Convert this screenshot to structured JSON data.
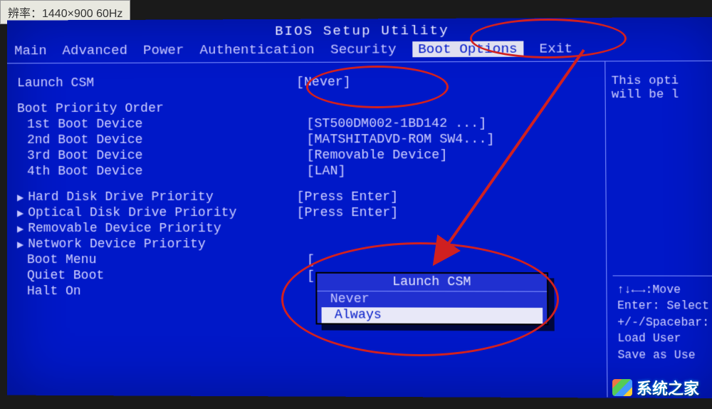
{
  "monitor_label": "辨率：1440×900 60Hz",
  "header": {
    "title": "BIOS Setup Utility",
    "tabs": [
      "Main",
      "Advanced",
      "Power",
      "Authentication",
      "Security",
      "Boot Options",
      "Exit"
    ],
    "active_tab": "Boot Options"
  },
  "settings": {
    "launch_csm": {
      "label": "Launch CSM",
      "value": "[Never]"
    },
    "boot_priority_header": "Boot Priority Order",
    "boot_devices": [
      {
        "label": "1st Boot Device",
        "value": "[ST500DM002-1BD142  ...]"
      },
      {
        "label": "2nd Boot Device",
        "value": "[MATSHITADVD-ROM SW4...]"
      },
      {
        "label": "3rd Boot Device",
        "value": "[Removable Device]"
      },
      {
        "label": "4th Boot Device",
        "value": "[LAN]"
      }
    ],
    "priorities": [
      {
        "label": "Hard Disk Drive Priority",
        "value": "[Press Enter]"
      },
      {
        "label": "Optical Disk Drive Priority",
        "value": "[Press Enter]"
      },
      {
        "label": "Removable Device Priority",
        "value": ""
      },
      {
        "label": "Network Device Priority",
        "value": ""
      }
    ],
    "extras": [
      {
        "label": "Boot Menu",
        "value": "["
      },
      {
        "label": "Quiet Boot",
        "value": "["
      },
      {
        "label": "Halt On",
        "value": ""
      }
    ]
  },
  "popup": {
    "title": "Launch CSM",
    "options": [
      "Never",
      "Always"
    ],
    "selected": "Always"
  },
  "help": {
    "description_line1": "This opti",
    "description_line2": "will be l",
    "keys": [
      "↑↓←→:Move",
      "Enter: Select",
      "+/-/Spacebar:",
      "    Load User",
      "    Save as Use"
    ]
  },
  "watermark": "系统之家"
}
